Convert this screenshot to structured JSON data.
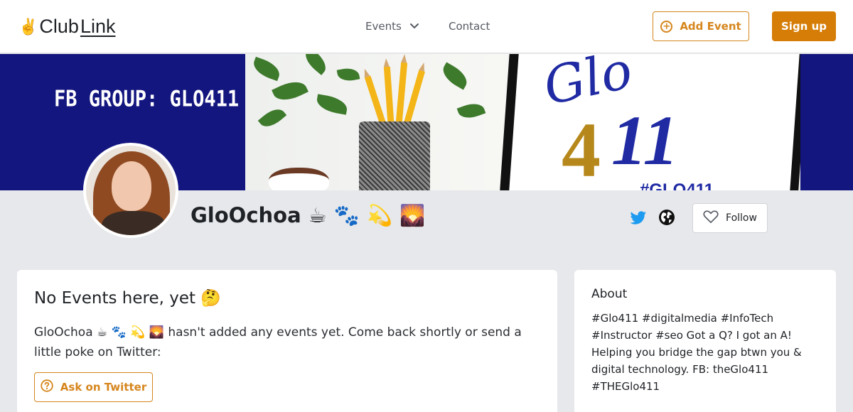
{
  "nav": {
    "logo_icon": "✌️",
    "logo_club": "Club",
    "logo_link": "Link",
    "events_label": "Events",
    "contact_label": "Contact",
    "add_event_label": "Add Event",
    "sign_up_label": "Sign up"
  },
  "banner": {
    "left_text": "FB GROUP: GLO411",
    "screen_script": "Glo",
    "screen_4": "4",
    "screen_11": "11",
    "screen_tag": "#GLO411"
  },
  "profile": {
    "name": "GloOchoa ☕ 🐾 💫 🌄",
    "follow_label": "Follow"
  },
  "events": {
    "title": "No Events here, yet 🤔",
    "message": "GloOchoa ☕ 🐾 💫 🌄 hasn't added any events yet. Come back shortly or send a little poke on Twitter:",
    "ask_label": "Ask on Twitter"
  },
  "about": {
    "title": "About",
    "text": "#Glo411 #digitalmedia #InfoTech #Instructor #seo Got a Q? I got an A! Helping you bridge the gap btwn you & digital technology. FB: theGlo411 #THEGlo411"
  },
  "colors": {
    "accent": "#d6861d",
    "banner_blue": "#13167e",
    "twitter_blue": "#1d9bf0"
  },
  "icons": [
    "chevron-down-icon",
    "plus-circle-icon",
    "twitter-icon",
    "globe-icon",
    "heart-icon",
    "question-circle-icon"
  ]
}
